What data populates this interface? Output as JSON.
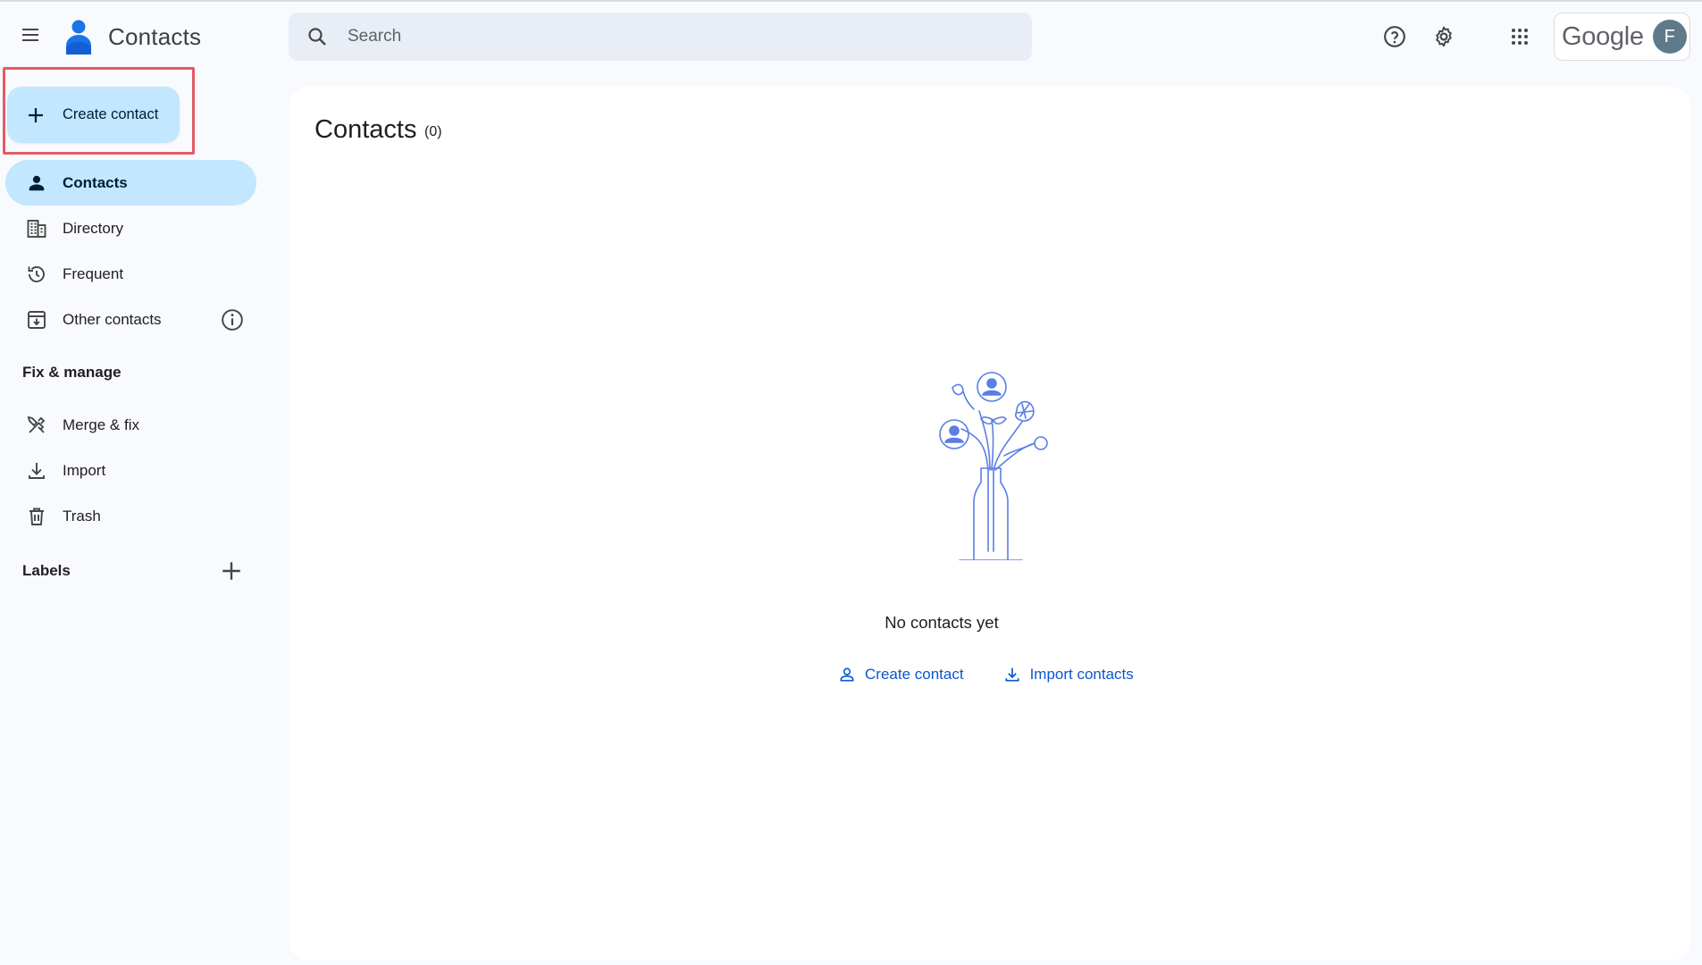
{
  "app": {
    "title": "Contacts",
    "brand_color": "#1a73e8"
  },
  "search": {
    "placeholder": "Search"
  },
  "topbar": {
    "icons": [
      "menu-icon",
      "help-icon",
      "settings-icon",
      "apps-grid-icon"
    ],
    "account_brand": "Google",
    "avatar_initial": "F"
  },
  "sidebar": {
    "create_label": "Create contact",
    "items": [
      {
        "label": "Contacts",
        "icon": "person-icon",
        "active": true
      },
      {
        "label": "Directory",
        "icon": "building-icon"
      },
      {
        "label": "Frequent",
        "icon": "history-icon"
      },
      {
        "label": "Other contacts",
        "icon": "inbox-download-icon"
      }
    ],
    "fix_manage_header": "Fix & manage",
    "fix_items": [
      {
        "label": "Merge & fix",
        "icon": "tools-icon"
      },
      {
        "label": "Import",
        "icon": "download-icon"
      },
      {
        "label": "Trash",
        "icon": "trash-icon"
      }
    ],
    "labels_header": "Labels"
  },
  "main": {
    "title": "Contacts",
    "count": "(0)",
    "empty_message": "No contacts yet",
    "actions": [
      {
        "label": "Create contact",
        "icon": "person-outline-icon"
      },
      {
        "label": "Import contacts",
        "icon": "download-icon"
      }
    ]
  },
  "colors": {
    "accent_bg": "#c2e7ff",
    "link": "#0b57d0",
    "highlight_border": "#e35b66",
    "illustration": "#5b7ee5"
  }
}
